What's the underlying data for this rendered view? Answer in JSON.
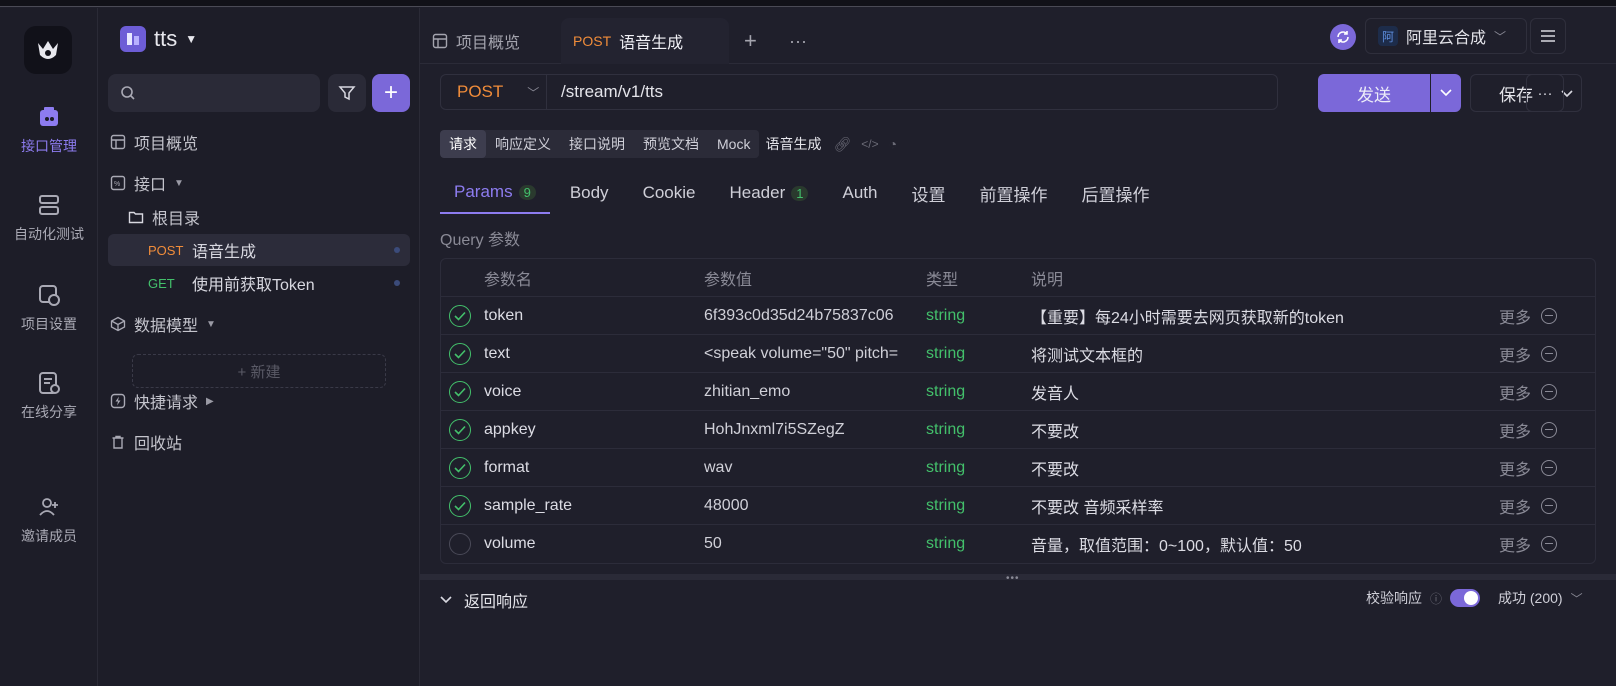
{
  "rail": {
    "items": [
      {
        "label": "接口管理",
        "icon": "api-icon"
      },
      {
        "label": "自动化测试",
        "icon": "automation-icon"
      },
      {
        "label": "项目设置",
        "icon": "settings-icon"
      },
      {
        "label": "在线分享",
        "icon": "share-icon"
      },
      {
        "label": "邀请成员",
        "icon": "invite-icon"
      }
    ]
  },
  "sidebar": {
    "project_name": "tts",
    "overview": "项目概览",
    "api": "接口",
    "root": "根目录",
    "items": [
      {
        "method": "POST",
        "name": "语音生成"
      },
      {
        "method": "GET",
        "name": "使用前获取Token"
      }
    ],
    "data_model": "数据模型",
    "new": "+ 新建",
    "quick_req": "快捷请求",
    "trash": "回收站"
  },
  "tabs": [
    {
      "label": "项目概览"
    },
    {
      "method": "POST",
      "label": "语音生成"
    }
  ],
  "env": {
    "label": "阿里云合成",
    "icon_text": "阿"
  },
  "request": {
    "method": "POST",
    "url": "/stream/v1/tts",
    "send": "发送",
    "save": "保存"
  },
  "segments": [
    "请求",
    "响应定义",
    "接口说明",
    "预览文档",
    "Mock"
  ],
  "segment_title": "语音生成",
  "subtabs": [
    {
      "label": "Params",
      "badge": "9"
    },
    {
      "label": "Body"
    },
    {
      "label": "Cookie"
    },
    {
      "label": "Header",
      "badge": "1"
    },
    {
      "label": "Auth"
    },
    {
      "label": "设置"
    },
    {
      "label": "前置操作"
    },
    {
      "label": "后置操作"
    }
  ],
  "query_label": "Query 参数",
  "table": {
    "headers": [
      "参数名",
      "参数值",
      "类型",
      "说明"
    ],
    "more_label": "更多",
    "rows": [
      {
        "enabled": true,
        "name": "token",
        "value": "6f393c0d35d24b75837c06",
        "type": "string",
        "desc": "【重要】每24小时需要去网页获取新的token"
      },
      {
        "enabled": true,
        "name": "text",
        "value": "<speak volume=\"50\" pitch=",
        "type": "string",
        "desc": "将测试文本框的"
      },
      {
        "enabled": true,
        "name": "voice",
        "value": "zhitian_emo",
        "type": "string",
        "desc": "发音人"
      },
      {
        "enabled": true,
        "name": "appkey",
        "value": "HohJnxml7i5SZegZ",
        "type": "string",
        "desc": "不要改"
      },
      {
        "enabled": true,
        "name": "format",
        "value": "wav",
        "type": "string",
        "desc": "不要改"
      },
      {
        "enabled": true,
        "name": "sample_rate",
        "value": "48000",
        "type": "string",
        "desc": "不要改 音频采样率"
      },
      {
        "enabled": false,
        "name": "volume",
        "value": "50",
        "type": "string",
        "desc": "音量，取值范围：0~100，默认值：50"
      }
    ]
  },
  "response": {
    "label": "返回响应",
    "verify": "校验响应",
    "status": "成功 (200)"
  }
}
